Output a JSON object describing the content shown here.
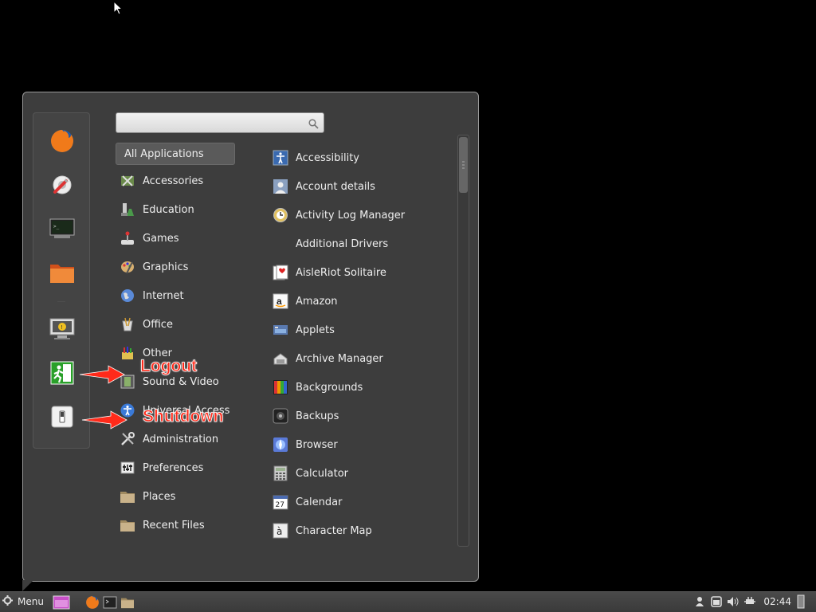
{
  "search": {
    "placeholder": ""
  },
  "categories": [
    {
      "label": "All Applications",
      "icon": "none",
      "active": true
    },
    {
      "label": "Accessories",
      "icon": "accessories-icon"
    },
    {
      "label": "Education",
      "icon": "education-icon"
    },
    {
      "label": "Games",
      "icon": "games-icon"
    },
    {
      "label": "Graphics",
      "icon": "graphics-icon"
    },
    {
      "label": "Internet",
      "icon": "internet-icon"
    },
    {
      "label": "Office",
      "icon": "office-icon"
    },
    {
      "label": "Other",
      "icon": "other-icon"
    },
    {
      "label": "Sound & Video",
      "icon": "sound-video-icon"
    },
    {
      "label": "Universal Access",
      "icon": "universal-access-icon"
    },
    {
      "label": "Administration",
      "icon": "administration-icon"
    },
    {
      "label": "Preferences",
      "icon": "preferences-icon"
    },
    {
      "label": "Places",
      "icon": "folder-icon"
    },
    {
      "label": "Recent Files",
      "icon": "folder-icon"
    }
  ],
  "apps": [
    {
      "label": "Accessibility",
      "icon": "accessibility-icon"
    },
    {
      "label": "Account details",
      "icon": "account-icon"
    },
    {
      "label": "Activity Log Manager",
      "icon": "activity-log-icon"
    },
    {
      "label": "Additional Drivers",
      "icon": "none"
    },
    {
      "label": "AisleRiot Solitaire",
      "icon": "cards-icon"
    },
    {
      "label": "Amazon",
      "icon": "amazon-icon"
    },
    {
      "label": "Applets",
      "icon": "applets-icon"
    },
    {
      "label": "Archive Manager",
      "icon": "archive-icon"
    },
    {
      "label": "Backgrounds",
      "icon": "backgrounds-icon"
    },
    {
      "label": "Backups",
      "icon": "backups-icon"
    },
    {
      "label": "Browser",
      "icon": "browser-icon"
    },
    {
      "label": "Calculator",
      "icon": "calculator-icon"
    },
    {
      "label": "Calendar",
      "icon": "calendar-icon"
    },
    {
      "label": "Character Map",
      "icon": "character-map-icon"
    }
  ],
  "favorites": [
    "firefox-icon",
    "system-settings-icon",
    "terminal-icon",
    "files-icon",
    "lock-screen-icon",
    "logout-icon",
    "shutdown-icon"
  ],
  "annotations": {
    "logout": "Logout",
    "shutdown": "Shutdown"
  },
  "taskbar": {
    "menu_label": "Menu",
    "clock": "02:44",
    "calendar_glyph": "27",
    "amazon_glyph": "a",
    "charmap_glyph": "à"
  },
  "colors": {
    "menu_bg": "#3d3d3d",
    "annotation": "#ff2a1a",
    "taskbar": "#404040"
  }
}
